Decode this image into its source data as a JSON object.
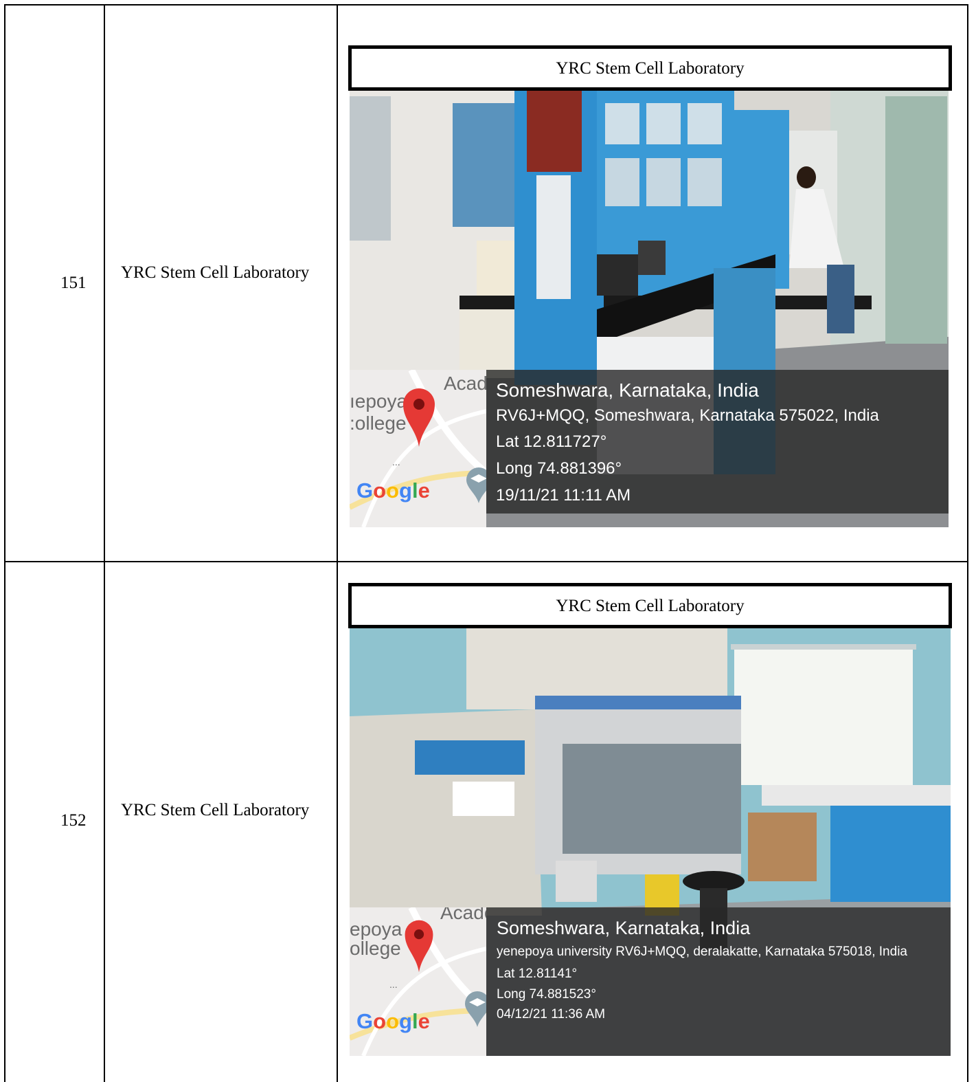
{
  "rows": [
    {
      "number": "151",
      "name": "YRC Stem Cell Laboratory",
      "photo": {
        "caption": "YRC Stem Cell Laboratory",
        "overlay": {
          "place": "Someshwara, Karnataka, India",
          "address": "RV6J+MQQ, Someshwara, Karnataka 575022, India",
          "lat": "Lat 12.811727°",
          "long": "Long 74.881396°",
          "datetime": "19/11/21 11:11 AM"
        },
        "map": {
          "label_top": "Acade",
          "label_left1": "ıepoya",
          "label_left2": ":ollege",
          "ellipsis": "...",
          "logo": "Google",
          "pin_icon": "map-pin-icon"
        }
      }
    },
    {
      "number": "152",
      "name": "YRC Stem Cell Laboratory",
      "photo": {
        "caption": "YRC Stem Cell Laboratory",
        "overlay": {
          "place": "Someshwara, Karnataka, India",
          "address": "yenepoya university RV6J+MQQ, deralakatte, Karnataka 575018, India",
          "lat": "Lat 12.81141°",
          "long": "Long 74.881523°",
          "datetime": "04/12/21 11:36 AM"
        },
        "map": {
          "label_top": "Acade",
          "label_left1": "epoya",
          "label_left2": "ollege",
          "ellipsis": "...",
          "logo": "Google",
          "pin_icon": "map-pin-icon"
        }
      }
    }
  ],
  "colors": {
    "google_blue": "#4285F4",
    "google_red": "#EA4335",
    "google_yellow": "#FBBC05",
    "google_green": "#34A853",
    "pin_red": "#E53935",
    "cabinet_blue": "#2f8fcf"
  }
}
